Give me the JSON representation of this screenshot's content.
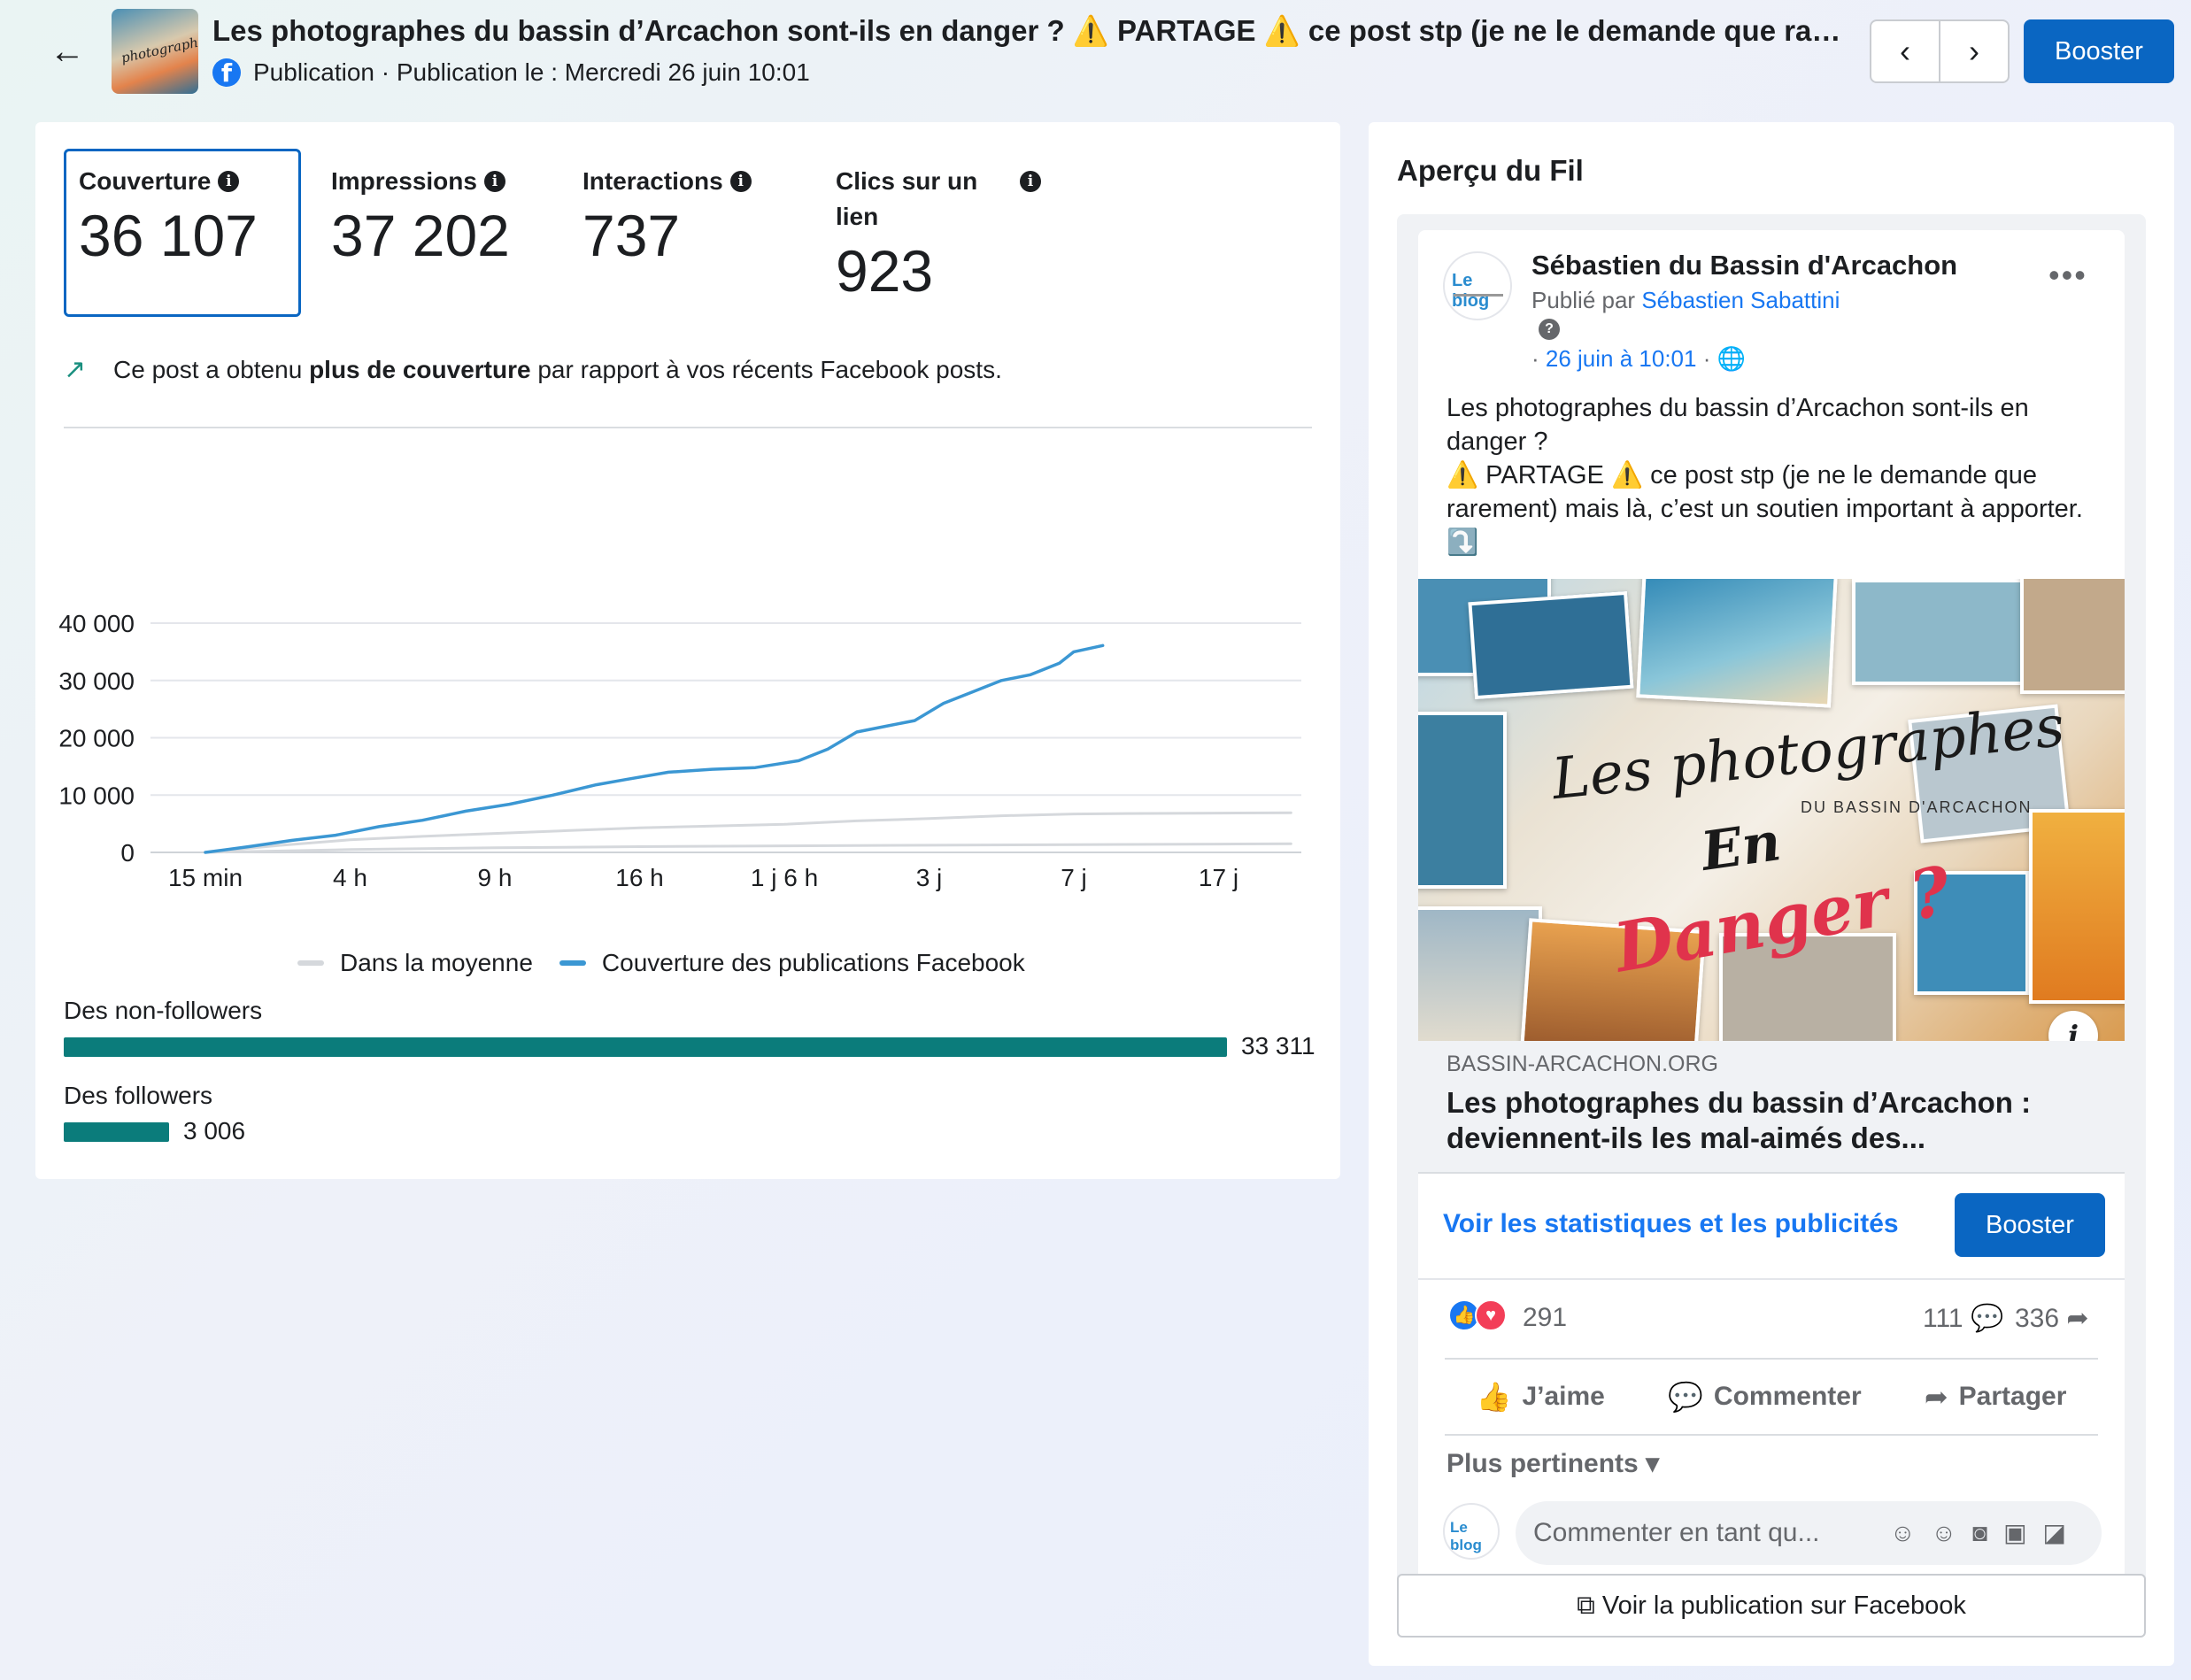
{
  "header": {
    "back_icon": "←",
    "thumb_text": "photographes",
    "title": "Les photographes du bassin d’Arcachon sont-ils en danger ? ⚠️ PARTAGE ⚠️ ce post stp (je ne le demande que raremen...",
    "subtitle": "Publication · Publication le : Mercredi 26 juin 10:01",
    "prev_icon": "‹",
    "next_icon": "›",
    "boost_label": "Booster"
  },
  "metrics": [
    {
      "label": "Couverture",
      "value": "36 107"
    },
    {
      "label": "Impressions",
      "value": "37 202"
    },
    {
      "label": "Interactions",
      "value": "737"
    },
    {
      "label": "Clics sur un lien",
      "value": "923"
    }
  ],
  "trend": {
    "pre": "Ce post a obtenu ",
    "bold": "plus de couverture",
    "post": " par rapport à vos récents Facebook posts."
  },
  "chart_data": {
    "type": "line",
    "categories": [
      "15 min",
      "4 h",
      "9 h",
      "16 h",
      "1 j 6 h",
      "3 j",
      "7 j",
      "17 j"
    ],
    "ylim": [
      0,
      40000
    ],
    "yticks": [
      "0",
      "10 000",
      "20 000",
      "30 000",
      "40 000"
    ],
    "grid": true,
    "legend_position": "bottom",
    "series": [
      {
        "name": "Dans la moyenne",
        "color": "#d5d8dc",
        "x": [
          0,
          0.5,
          1,
          1.5,
          2,
          2.5,
          3,
          3.5,
          4,
          4.5,
          5,
          5.5,
          6,
          6.5,
          7,
          7.5
        ],
        "values": [
          0,
          1200,
          2200,
          2800,
          3300,
          3800,
          4300,
          4600,
          4900,
          5500,
          5900,
          6400,
          6700,
          6800,
          6850,
          6900
        ]
      },
      {
        "name": "Dans la moyenne (bas)",
        "color": "#d5d8dc",
        "x": [
          0,
          1,
          2,
          3,
          4,
          5,
          6,
          7,
          7.5
        ],
        "values": [
          0,
          500,
          800,
          1000,
          1150,
          1250,
          1350,
          1450,
          1500
        ]
      },
      {
        "name": "Couverture des publications Facebook",
        "color": "#3b97d3",
        "x": [
          0,
          0.3,
          0.6,
          0.9,
          1.2,
          1.5,
          1.8,
          2.1,
          2.4,
          2.7,
          2.9,
          3.2,
          3.5,
          3.8,
          4.1,
          4.3,
          4.5,
          4.7,
          4.9,
          5.1,
          5.3,
          5.5,
          5.7,
          5.9,
          6.0,
          6.2
        ],
        "values": [
          0,
          1000,
          2100,
          3000,
          4500,
          5600,
          7200,
          8400,
          10000,
          11800,
          12700,
          14000,
          14500,
          14800,
          16000,
          18000,
          21000,
          22000,
          23000,
          26000,
          28000,
          30000,
          31000,
          33000,
          35000,
          36100
        ]
      }
    ]
  },
  "legend": [
    {
      "label": "Dans la moyenne",
      "color": "#d5d8dc"
    },
    {
      "label": "Couverture des publications Facebook",
      "color": "#3b97d3"
    }
  ],
  "audience": [
    {
      "label": "Des non-followers",
      "value": 33311,
      "display": "33 311"
    },
    {
      "label": "Des followers",
      "value": 3006,
      "display": "3 006"
    }
  ],
  "preview": {
    "title": "Aperçu du Fil",
    "page_name": "Sébastien du Bassin d'Arcachon",
    "avatar_text": "Le blog",
    "published_by_prefix": "Publié par ",
    "published_by": "Sébastien Sabattini",
    "date": "26 juin à 10:01",
    "post_text_lines": [
      "Les photographes du bassin d’Arcachon sont-ils en danger ?",
      "⚠️ PARTAGE ⚠️ ce post stp (je ne le demande que rarement) mais là,  c’est un soutien important à apporter. ⤵️"
    ],
    "image_title": "Les photographes",
    "image_sub": "DU BASSIN D'ARCACHON",
    "image_en": "En",
    "image_danger": "Danger ?",
    "link_domain": "BASSIN-ARCACHON.ORG",
    "link_title": "Les photographes du bassin d’Arcachon : deviennent-ils les mal-aimés des...",
    "stats_link": "Voir les statistiques et les publicités",
    "boost_label": "Booster",
    "reactions_count": "291",
    "comments_count": "111",
    "shares_count": "336",
    "actions": [
      "J’aime",
      "Commenter",
      "Partager"
    ],
    "sort_label": "Plus pertinents",
    "comment_placeholder": "Commenter en tant qu...",
    "view_on_fb": "Voir la publication sur Facebook"
  }
}
